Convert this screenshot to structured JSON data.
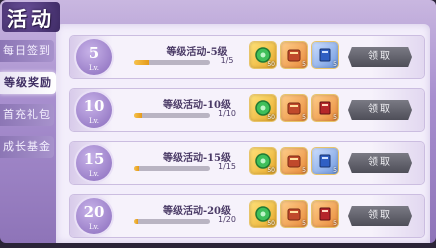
{
  "window": {
    "title": "活动"
  },
  "sidebar": {
    "items": [
      {
        "label": "每日签到",
        "active": false
      },
      {
        "label": "等级奖励",
        "active": true
      },
      {
        "label": "首充礼包",
        "active": false
      },
      {
        "label": "成长基金",
        "active": false
      }
    ]
  },
  "rows": [
    {
      "level": "5",
      "unit": "Lv.",
      "title": "等级活动-5级",
      "progress_text": "1/5",
      "progress": 0.2,
      "rewards": [
        {
          "icon": "green-jade-icon",
          "qty": "50"
        },
        {
          "icon": "scroll-bundle-icon",
          "qty": "5"
        },
        {
          "icon": "blue-book-icon",
          "qty": "5"
        }
      ],
      "button": "领取"
    },
    {
      "level": "10",
      "unit": "Lv.",
      "title": "等级活动-10级",
      "progress_text": "1/10",
      "progress": 0.1,
      "rewards": [
        {
          "icon": "green-jade-icon",
          "qty": "50"
        },
        {
          "icon": "scroll-bundle-icon",
          "qty": "5"
        },
        {
          "icon": "red-book-icon",
          "qty": "5"
        }
      ],
      "button": "领取"
    },
    {
      "level": "15",
      "unit": "Lv.",
      "title": "等级活动-15级",
      "progress_text": "1/15",
      "progress": 0.07,
      "rewards": [
        {
          "icon": "green-jade-icon",
          "qty": "50"
        },
        {
          "icon": "scroll-bundle-icon",
          "qty": "5"
        },
        {
          "icon": "blue-book-icon",
          "qty": "5"
        }
      ],
      "button": "领取"
    },
    {
      "level": "20",
      "unit": "Lv.",
      "title": "等级活动-20级",
      "progress_text": "1/20",
      "progress": 0.05,
      "rewards": [
        {
          "icon": "green-jade-icon",
          "qty": "50"
        },
        {
          "icon": "scroll-bundle-icon",
          "qty": "5"
        },
        {
          "icon": "red-book-icon",
          "qty": "5"
        }
      ],
      "button": "领取"
    }
  ],
  "colors": {
    "accent": "#8a6cbd",
    "progress": "#e49a1a",
    "button": "#5a5a64"
  }
}
